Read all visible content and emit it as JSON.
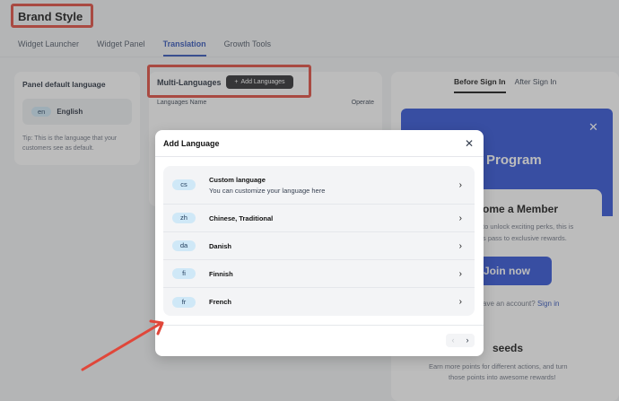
{
  "page": {
    "title": "Brand Style"
  },
  "tabs": [
    "Widget Launcher",
    "Widget Panel",
    "Translation",
    "Growth Tools"
  ],
  "active_tab": "Translation",
  "panel_default": {
    "heading": "Panel default language",
    "code": "en",
    "language": "English",
    "tip": "Tip: This is the language that your customers see as default."
  },
  "multi": {
    "heading": "Multi-Languages",
    "add_button": "Add Languages",
    "col_name": "Languages Name",
    "col_operate": "Operate"
  },
  "preview": {
    "tabs": [
      "Before Sign In",
      "After Sign In"
    ],
    "banner_title": "Program",
    "member_title": "ome a Member",
    "member_text_1": "to unlock exciting perks, this is",
    "member_text_2": "s pass to exclusive rewards.",
    "join_label": "Join now",
    "signin_text": "ave an account?",
    "signin_link": "Sign in",
    "seeds_title": "seeds",
    "seeds_text_1": "Earn more points for different actions, and turn",
    "seeds_text_2": "those points into awesome rewards!"
  },
  "modal": {
    "title": "Add Language",
    "items": [
      {
        "code": "cs",
        "name": "Custom language",
        "desc": "You can customize your language here"
      },
      {
        "code": "zh",
        "name": "Chinese, Traditional"
      },
      {
        "code": "da",
        "name": "Danish"
      },
      {
        "code": "fi",
        "name": "Finnish"
      },
      {
        "code": "fr",
        "name": "French"
      }
    ]
  },
  "colors": {
    "accent": "#2d4fb7",
    "brand_blue": "#2a4ed6",
    "annotation_red": "#e0473a"
  }
}
